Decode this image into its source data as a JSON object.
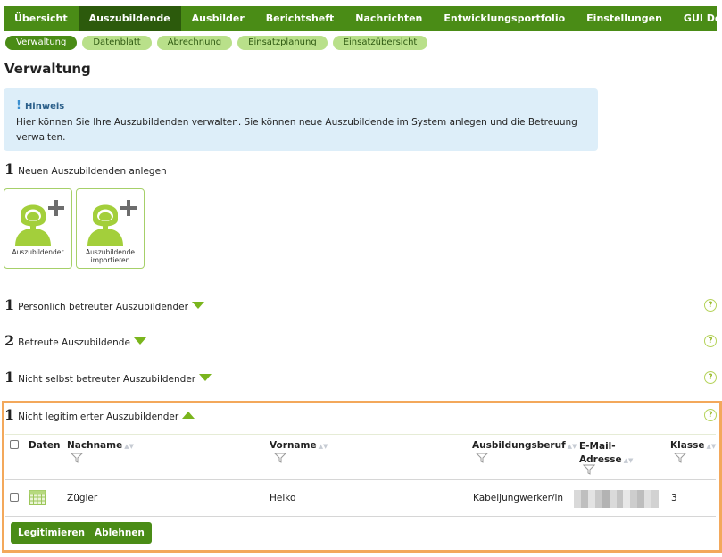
{
  "topnav": {
    "tabs": [
      {
        "label": "Übersicht"
      },
      {
        "label": "Auszubildende"
      },
      {
        "label": "Ausbilder"
      },
      {
        "label": "Berichtsheft"
      },
      {
        "label": "Nachrichten"
      },
      {
        "label": "Entwicklungsportfolio"
      },
      {
        "label": "Einstellungen"
      },
      {
        "label": "GUI Demo"
      }
    ],
    "active": "Auszubildende"
  },
  "subnav": {
    "items": [
      {
        "label": "Verwaltung"
      },
      {
        "label": "Datenblatt"
      },
      {
        "label": "Abrechnung"
      },
      {
        "label": "Einsatzplanung"
      },
      {
        "label": "Einsatzübersicht"
      }
    ],
    "active": "Verwaltung"
  },
  "page": {
    "title": "Verwaltung"
  },
  "notice": {
    "title": "Hinweis",
    "text": "Hier können Sie Ihre Auszubildenden verwalten. Sie können neue Auszubildende im System anlegen und die Betreuung verwalten."
  },
  "create": {
    "count": "1",
    "label": "Neuen Auszubildenden anlegen",
    "cards": [
      {
        "caption": "Auszubildender"
      },
      {
        "caption": "Auszubildende importieren"
      }
    ]
  },
  "sections": [
    {
      "count": "1",
      "label": "Persönlich betreuter Auszubildender"
    },
    {
      "count": "2",
      "label": "Betreute Auszubildende"
    },
    {
      "count": "1",
      "label": "Nicht selbst betreuter Auszubildender"
    },
    {
      "count": "1",
      "label": "Nicht legitimierter Auszubildender"
    }
  ],
  "help_glyph": "?",
  "table": {
    "headers": {
      "daten": "Daten",
      "nachname": "Nachname",
      "vorname": "Vorname",
      "beruf": "Ausbildungsberuf",
      "email": "E-Mail-Adresse",
      "klasse": "Klasse"
    },
    "rows": [
      {
        "nachname": "Zügler",
        "vorname": "Heiko",
        "beruf": "Kabeljungwerker/in",
        "klasse": "3"
      }
    ]
  },
  "actions": {
    "legitimize": "Legitimieren",
    "reject": "Ablehnen"
  },
  "colors": {
    "nav_green": "#4a8c16",
    "nav_active": "#2c5a0c",
    "pill_green": "#b9e08a",
    "accent_green": "#7ab51d",
    "highlight_orange": "#f3a85b",
    "notice_bg": "#ddeef9"
  }
}
